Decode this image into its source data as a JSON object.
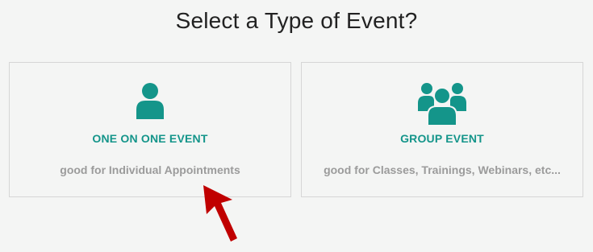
{
  "header": {
    "title": "Select a Type of Event?"
  },
  "cards": [
    {
      "icon": "single-user-icon",
      "title": "ONE ON ONE EVENT",
      "description": "good for Individual Appointments"
    },
    {
      "icon": "user-group-icon",
      "title": "GROUP EVENT",
      "description": "good for Classes, Trainings, Webinars, etc..."
    }
  ],
  "colors": {
    "accent": "#14958a",
    "muted_text": "#9b9b9b",
    "border": "#d6d6d6",
    "background": "#f4f5f4",
    "arrow": "#c00000"
  }
}
